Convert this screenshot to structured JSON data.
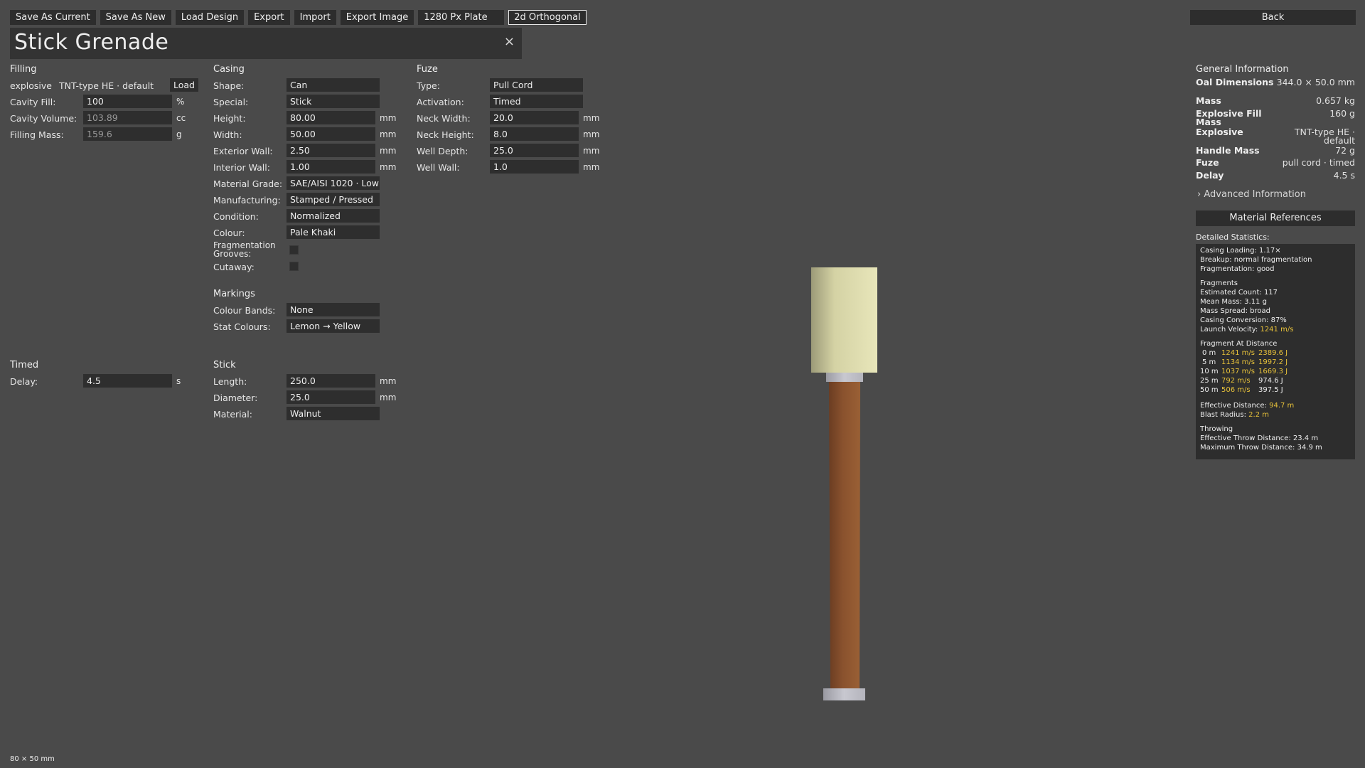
{
  "toolbar": {
    "save_as_current": "Save As Current",
    "save_as_new": "Save As New",
    "load_design": "Load Design",
    "export": "Export",
    "import": "Import",
    "export_image": "Export Image",
    "plate": "1280 Px Plate",
    "view": "2d Orthogonal",
    "back": "Back"
  },
  "title": {
    "text": "Stick Grenade",
    "close": "×"
  },
  "filling": {
    "head": "Filling",
    "explosive_label": "explosive",
    "explosive_value": "TNT-type HE · default",
    "load": "Load",
    "cavity_fill_label": "Cavity Fill:",
    "cavity_fill_value": "100",
    "cavity_fill_unit": "%",
    "cavity_volume_label": "Cavity Volume:",
    "cavity_volume_value": "103.89",
    "cavity_volume_unit": "cc",
    "filling_mass_label": "Filling Mass:",
    "filling_mass_value": "159.6",
    "filling_mass_unit": "g"
  },
  "casing": {
    "head": "Casing",
    "shape_label": "Shape:",
    "shape_value": "Can",
    "special_label": "Special:",
    "special_value": "Stick",
    "height_label": "Height:",
    "height_value": "80.00",
    "height_unit": "mm",
    "width_label": "Width:",
    "width_value": "50.00",
    "width_unit": "mm",
    "ext_wall_label": "Exterior Wall:",
    "ext_wall_value": "2.50",
    "ext_wall_unit": "mm",
    "int_wall_label": "Interior Wall:",
    "int_wall_value": "1.00",
    "int_wall_unit": "mm",
    "grade_label": "Material Grade:",
    "grade_value": "SAE/AISI 1020 · Low",
    "manufacturing_label": "Manufacturing:",
    "manufacturing_value": "Stamped / Pressed",
    "condition_label": "Condition:",
    "condition_value": "Normalized",
    "colour_label": "Colour:",
    "colour_value": "Pale Khaki",
    "frag_label": "Fragmentation Grooves:",
    "cutaway_label": "Cutaway:"
  },
  "markings": {
    "head": "Markings",
    "bands_label": "Colour Bands:",
    "bands_value": "None",
    "stat_label": "Stat Colours:",
    "stat_value": "Lemon → Yellow"
  },
  "fuze": {
    "head": "Fuze",
    "type_label": "Type:",
    "type_value": "Pull Cord",
    "activation_label": "Activation:",
    "activation_value": "Timed",
    "neck_width_label": "Neck Width:",
    "neck_width_value": "20.0",
    "neck_width_unit": "mm",
    "neck_height_label": "Neck Height:",
    "neck_height_value": "8.0",
    "neck_height_unit": "mm",
    "well_depth_label": "Well Depth:",
    "well_depth_value": "25.0",
    "well_depth_unit": "mm",
    "well_wall_label": "Well Wall:",
    "well_wall_value": "1.0",
    "well_wall_unit": "mm"
  },
  "timed": {
    "head": "Timed",
    "delay_label": "Delay:",
    "delay_value": "4.5",
    "delay_unit": "s"
  },
  "stick": {
    "head": "Stick",
    "length_label": "Length:",
    "length_value": "250.0",
    "length_unit": "mm",
    "diameter_label": "Diameter:",
    "diameter_value": "25.0",
    "diameter_unit": "mm",
    "material_label": "Material:",
    "material_value": "Walnut"
  },
  "general": {
    "head": "General Information",
    "dims_label": "Oal Dimensions",
    "dims_value": "344.0 × 50.0 mm",
    "mass_label": "Mass",
    "mass_value": "0.657 kg",
    "fill_mass_label": "Explosive Fill Mass",
    "fill_mass_value": "160 g",
    "explosive_label": "Explosive",
    "explosive_value": "TNT-type HE · default",
    "handle_label": "Handle Mass",
    "handle_value": "72 g",
    "fuze_label": "Fuze",
    "fuze_value": "pull cord · timed",
    "delay_label": "Delay",
    "delay_value": "4.5 s",
    "advanced": "› Advanced Information",
    "material_refs": "Material References",
    "detailed": "Detailed Statistics:"
  },
  "stats": {
    "casing_loading": "Casing Loading: 1.17×",
    "breakup": "Breakup: normal fragmentation",
    "fragmentation": "Fragmentation: good",
    "fragments_head": "Fragments",
    "estimated": "Estimated Count: 117",
    "mean_mass": "Mean Mass: 3.11 g",
    "spread": "Mass Spread: broad",
    "conversion": "Casing Conversion: 87%",
    "launch_label": "Launch Velocity:",
    "launch_value": "1241 m/s",
    "distance_head": "Fragment At Distance",
    "rows": [
      {
        "d": "0 m",
        "v": "1241 m/s",
        "e": "2389.6 J",
        "v_hl": true,
        "e_hl": true
      },
      {
        "d": "5 m",
        "v": "1134 m/s",
        "e": "1997.2 J",
        "v_hl": true,
        "e_hl": true
      },
      {
        "d": "10 m",
        "v": "1037 m/s",
        "e": "1669.3 J",
        "v_hl": true,
        "e_hl": true
      },
      {
        "d": "25 m",
        "v": "792 m/s",
        "e": "974.6 J",
        "v_hl": true,
        "e_hl": false
      },
      {
        "d": "50 m",
        "v": "506 m/s",
        "e": "397.5 J",
        "v_hl": true,
        "e_hl": false
      }
    ],
    "eff_label": "Effective Distance:",
    "eff_value": "94.7 m",
    "blast_label": "Blast Radius:",
    "blast_value": "2.2 m",
    "throwing_head": "Throwing",
    "eff_throw": "Effective Throw Distance: 23.4 m",
    "max_throw": "Maximum Throw Distance: 34.9 m"
  },
  "footer": {
    "dims": "80 × 50 mm"
  },
  "colors": {
    "background": "#4a4a4a",
    "panel": "#2d2d2d",
    "highlight": "#e8c23a",
    "casing": "#e0deb0",
    "stick": "#8a522e",
    "metal": "#c8c8d0"
  }
}
